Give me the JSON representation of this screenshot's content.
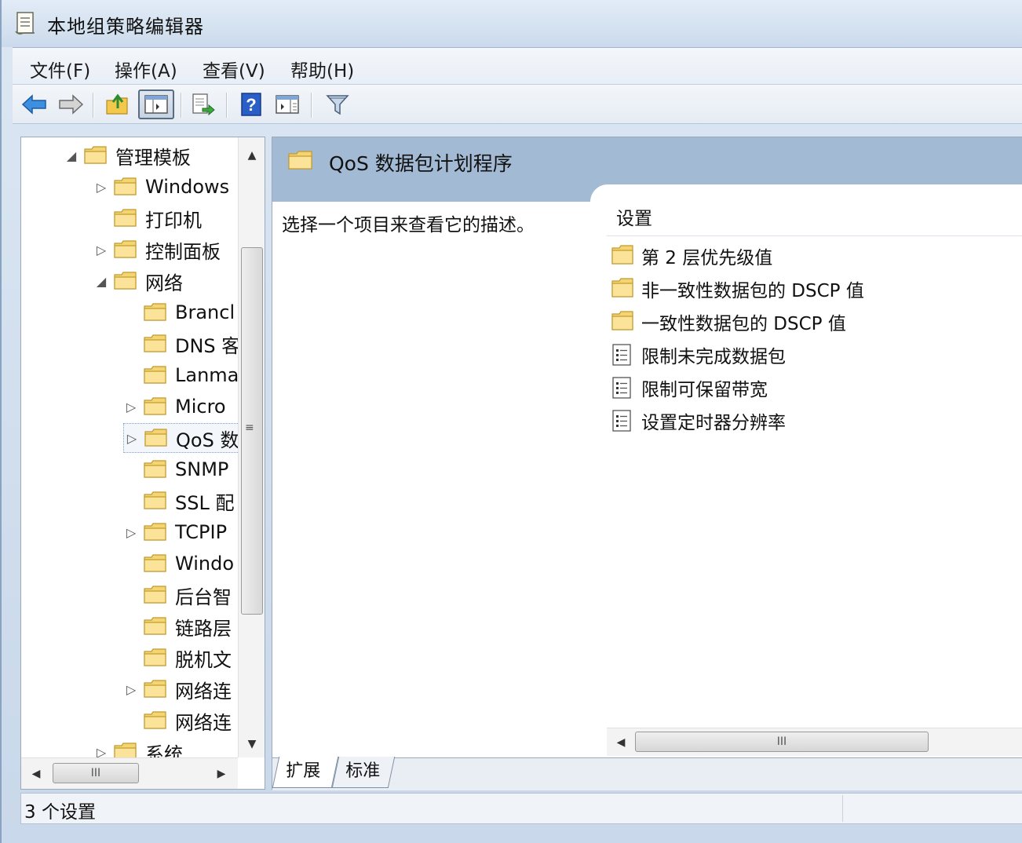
{
  "window": {
    "title": "本地组策略编辑器"
  },
  "menu": [
    {
      "label": "文件(F)"
    },
    {
      "label": "操作(A)"
    },
    {
      "label": "查看(V)"
    },
    {
      "label": "帮助(H)"
    }
  ],
  "toolbar": {
    "buttons": [
      "back-icon",
      "forward-icon",
      "up-folder-icon",
      "show-hide-tree-icon",
      "export-list-icon",
      "help-icon",
      "show-hide-action-pane-icon",
      "filter-icon"
    ]
  },
  "tree": {
    "items": [
      {
        "label": "管理模板",
        "arrow": "◢"
      },
      {
        "label": "Windows",
        "arrow": "▷"
      },
      {
        "label": "打印机",
        "arrow": ""
      },
      {
        "label": "控制面板",
        "arrow": "▷"
      },
      {
        "label": "网络",
        "arrow": "◢"
      },
      {
        "label": "Brancl",
        "arrow": ""
      },
      {
        "label": "DNS 客",
        "arrow": ""
      },
      {
        "label": "Lanma",
        "arrow": ""
      },
      {
        "label": "Micro",
        "arrow": "▷"
      },
      {
        "label": "QoS 数",
        "arrow": "▷"
      },
      {
        "label": "SNMP",
        "arrow": ""
      },
      {
        "label": "SSL 配",
        "arrow": ""
      },
      {
        "label": "TCPIP",
        "arrow": "▷"
      },
      {
        "label": "Windo",
        "arrow": ""
      },
      {
        "label": "后台智",
        "arrow": ""
      },
      {
        "label": "链路层",
        "arrow": ""
      },
      {
        "label": "脱机文",
        "arrow": ""
      },
      {
        "label": "网络连",
        "arrow": "▷"
      },
      {
        "label": "网络连",
        "arrow": ""
      },
      {
        "label": "系统",
        "arrow": "▷"
      }
    ],
    "selected_index": 9
  },
  "right": {
    "header_title": "QoS 数据包计划程序",
    "description": "选择一个项目来查看它的描述。",
    "column_header": "设置",
    "settings": [
      {
        "label": "第 2 层优先级值",
        "type": "folder"
      },
      {
        "label": "非一致性数据包的 DSCP 值",
        "type": "folder"
      },
      {
        "label": "一致性数据包的 DSCP 值",
        "type": "folder"
      },
      {
        "label": "限制未完成数据包",
        "type": "setting"
      },
      {
        "label": "限制可保留带宽",
        "type": "setting"
      },
      {
        "label": "设置定时器分辨率",
        "type": "setting"
      }
    ],
    "tabs": [
      {
        "label": "扩展",
        "active": true
      },
      {
        "label": "标准",
        "active": false
      }
    ]
  },
  "status": {
    "text": "3 个设置"
  },
  "scroll": {
    "grip": "III"
  }
}
